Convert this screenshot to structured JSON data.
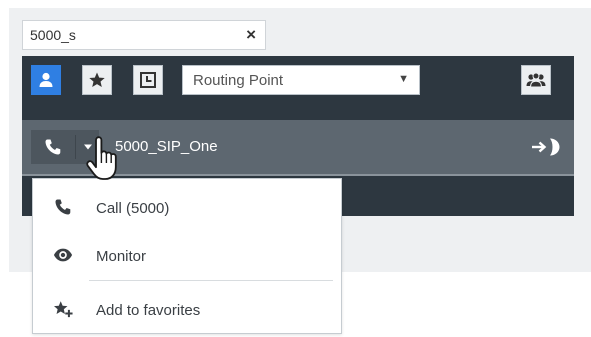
{
  "search": {
    "value": "5000_s",
    "clear_glyph": "×"
  },
  "toolbar": {
    "buttons": [
      {
        "icon": "person-icon",
        "active": true
      },
      {
        "icon": "star-icon",
        "active": false
      },
      {
        "icon": "recent-history-icon",
        "active": false
      }
    ],
    "type_select": {
      "selected": "Routing Point",
      "caret": "▼"
    },
    "team_icon": "group-icon"
  },
  "contact": {
    "name": "5000_SIP_One",
    "call_icon": "phone-icon",
    "transfer_icon": "transfer-icon"
  },
  "menu": {
    "items": [
      {
        "label": "Call (5000)",
        "icon": "phone-icon"
      },
      {
        "label": "Monitor",
        "icon": "eye-icon"
      },
      {
        "label": "Add to favorites",
        "icon": "star-add-icon"
      }
    ]
  },
  "colors": {
    "accent": "#2f7fe3",
    "panel_dark": "#2d3740",
    "row_bg": "#5d6770"
  }
}
